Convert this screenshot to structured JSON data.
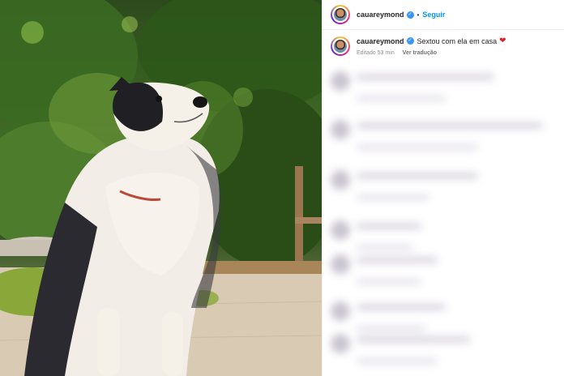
{
  "post": {
    "username": "cauareymond",
    "follow_label": "Seguir",
    "separator": "•",
    "verified_glyph": "✓",
    "caption": "Sextou com ela em casa",
    "heart": "❤",
    "edited_label": "Editado",
    "time": "53 min",
    "translate_label": "Ver tradução"
  },
  "icons": {
    "verified": "verified-badge-icon",
    "heart": "heart-emoji-icon"
  },
  "colors": {
    "accent": "#0095f6",
    "text": "#262626",
    "muted": "#8e8e8e",
    "heart": "#e0212a"
  }
}
